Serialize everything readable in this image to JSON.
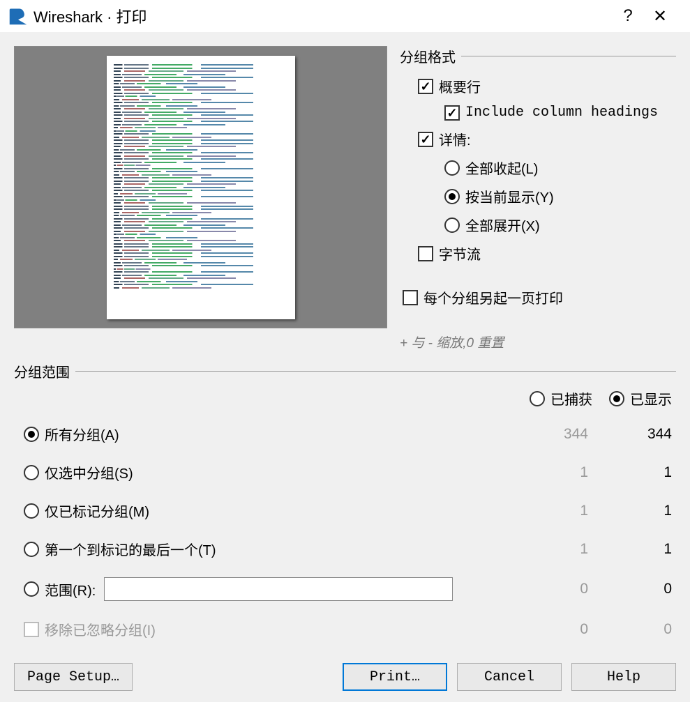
{
  "title": "Wireshark · 打印",
  "format": {
    "legend": "分组格式",
    "summary": {
      "label": "概要行",
      "checked": true
    },
    "include_headings": {
      "label": "Include column headings",
      "checked": true
    },
    "details": {
      "label": "详情:",
      "checked": true
    },
    "collapse_all": {
      "label": "全部收起(L)",
      "selected": false
    },
    "as_displayed": {
      "label": "按当前显示(Y)",
      "selected": true
    },
    "expand_all": {
      "label": "全部展开(X)",
      "selected": false
    },
    "bytes": {
      "label": "字节流",
      "checked": false
    },
    "each_new_page": {
      "label": "每个分组另起一页打印",
      "checked": false
    },
    "hint": "+ 与 - 缩放,0 重置"
  },
  "range": {
    "legend": "分组范围",
    "captured": {
      "label": "已捕获",
      "selected": false
    },
    "displayed": {
      "label": "已显示",
      "selected": true
    },
    "all": {
      "label": "所有分组(A)",
      "selected": true,
      "captured": "344",
      "displayed": "344"
    },
    "selected": {
      "label": "仅选中分组(S)",
      "selected": false,
      "captured": "1",
      "displayed": "1"
    },
    "marked": {
      "label": "仅已标记分组(M)",
      "selected": false,
      "captured": "1",
      "displayed": "1"
    },
    "first_to_last_marked": {
      "label": "第一个到标记的最后一个(T)",
      "selected": false,
      "captured": "1",
      "displayed": "1"
    },
    "range_opt": {
      "label": "范围(R):",
      "selected": false,
      "value": "",
      "captured": "0",
      "displayed": "0"
    },
    "remove_ignored": {
      "label": "移除已忽略分组(I)",
      "checked": false,
      "enabled": false,
      "captured": "0",
      "displayed": "0"
    }
  },
  "buttons": {
    "page_setup": "Page Setup…",
    "print": "Print…",
    "cancel": "Cancel",
    "help": "Help"
  }
}
